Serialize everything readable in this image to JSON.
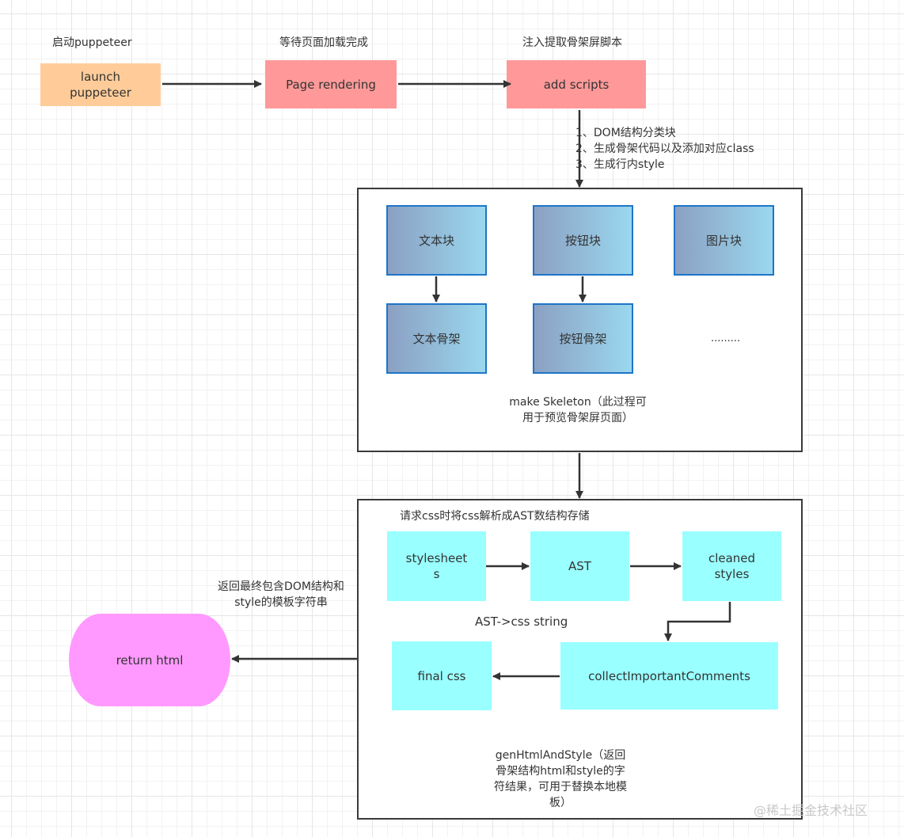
{
  "top_row": {
    "launch": {
      "caption": "启动puppeteer",
      "label_line1": "launch",
      "label_line2": "puppeteer",
      "color": "#ffcc99"
    },
    "render": {
      "caption": "等待页面加载完成",
      "label": "Page rendering",
      "color": "#ff9999"
    },
    "scripts": {
      "caption": "注入提取骨架屏脚本",
      "label": "add scripts",
      "color": "#ff9999"
    }
  },
  "scripts_notes": [
    "1、DOM结构分类块",
    "2、生成骨架代码以及添加对应class",
    "3、生成行内style"
  ],
  "skeleton_group": {
    "blocks": [
      {
        "label": "文本块"
      },
      {
        "label": "按钮块"
      },
      {
        "label": "图片块"
      }
    ],
    "skeletons": [
      {
        "label": "文本骨架"
      },
      {
        "label": "按钮骨架"
      }
    ],
    "ellipsis": ".........",
    "caption_line1": "make Skeleton（此过程可",
    "caption_line2": "用于预览骨架屏页面）",
    "gradient_start": "#8ba0c2",
    "gradient_end": "#9ad8ef",
    "border_color": "#1f75c7"
  },
  "css_group": {
    "header": "请求css时将css解析成AST数结构存储",
    "stylesheets_line1": "stylesheet",
    "stylesheets_line2": "s",
    "ast": "AST",
    "cleaned_line1": "cleaned",
    "cleaned_line2": "styles",
    "ast_to_css": "AST->css string",
    "final_css": "final css",
    "collect": "collectImportantComments",
    "caption_lines": [
      "genHtmlAndStyle（返回",
      "骨架结构html和style的字",
      "符结果，可用于替换本地模",
      "板）"
    ],
    "color": "#99ffff"
  },
  "return": {
    "caption_line1": "返回最终包含DOM结构和",
    "caption_line2": "style的模板字符串",
    "label": "return html",
    "color": "#ff99ff"
  },
  "watermark": "@稀土掘金技术社区"
}
